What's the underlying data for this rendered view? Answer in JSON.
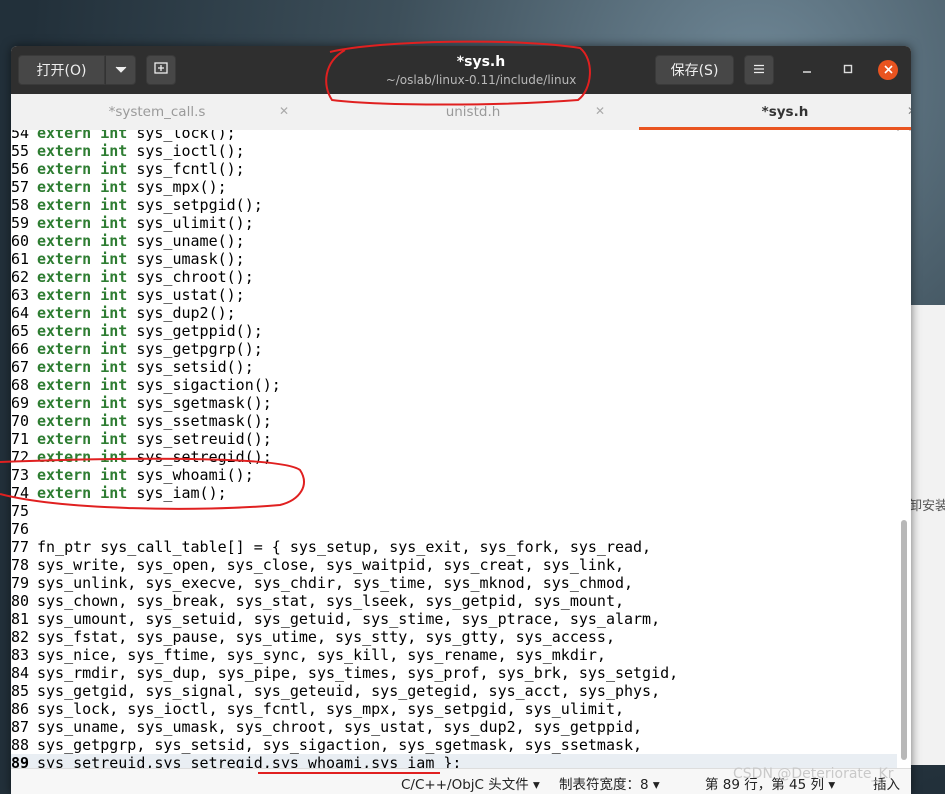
{
  "titlebar": {
    "open_label": "打开(O)",
    "title": "*sys.h",
    "subtitle": "~/oslab/linux-0.11/include/linux",
    "save_label": "保存(S)"
  },
  "tabs": [
    {
      "label": "*system_call.s"
    },
    {
      "label": "unistd.h"
    },
    {
      "label": "*sys.h"
    }
  ],
  "editor": {
    "lines": [
      {
        "n": "54",
        "kw": "extern int",
        "rest": " sys_lock();"
      },
      {
        "n": "55",
        "kw": "extern int",
        "rest": " sys_ioctl();"
      },
      {
        "n": "56",
        "kw": "extern int",
        "rest": " sys_fcntl();"
      },
      {
        "n": "57",
        "kw": "extern int",
        "rest": " sys_mpx();"
      },
      {
        "n": "58",
        "kw": "extern int",
        "rest": " sys_setpgid();"
      },
      {
        "n": "59",
        "kw": "extern int",
        "rest": " sys_ulimit();"
      },
      {
        "n": "60",
        "kw": "extern int",
        "rest": " sys_uname();"
      },
      {
        "n": "61",
        "kw": "extern int",
        "rest": " sys_umask();"
      },
      {
        "n": "62",
        "kw": "extern int",
        "rest": " sys_chroot();"
      },
      {
        "n": "63",
        "kw": "extern int",
        "rest": " sys_ustat();"
      },
      {
        "n": "64",
        "kw": "extern int",
        "rest": " sys_dup2();"
      },
      {
        "n": "65",
        "kw": "extern int",
        "rest": " sys_getppid();"
      },
      {
        "n": "66",
        "kw": "extern int",
        "rest": " sys_getpgrp();"
      },
      {
        "n": "67",
        "kw": "extern int",
        "rest": " sys_setsid();"
      },
      {
        "n": "68",
        "kw": "extern int",
        "rest": " sys_sigaction();"
      },
      {
        "n": "69",
        "kw": "extern int",
        "rest": " sys_sgetmask();"
      },
      {
        "n": "70",
        "kw": "extern int",
        "rest": " sys_ssetmask();"
      },
      {
        "n": "71",
        "kw": "extern int",
        "rest": " sys_setreuid();"
      },
      {
        "n": "72",
        "kw": "extern int",
        "rest": " sys_setregid();"
      },
      {
        "n": "73",
        "kw": "extern int",
        "rest": " sys_whoami();"
      },
      {
        "n": "74",
        "kw": "extern int",
        "rest": " sys_iam();"
      },
      {
        "n": "75",
        "kw": "",
        "rest": ""
      },
      {
        "n": "76",
        "kw": "",
        "rest": ""
      },
      {
        "n": "77",
        "kw": "",
        "rest": "fn_ptr sys_call_table[] = { sys_setup, sys_exit, sys_fork, sys_read,"
      },
      {
        "n": "78",
        "kw": "",
        "rest": "sys_write, sys_open, sys_close, sys_waitpid, sys_creat, sys_link,"
      },
      {
        "n": "79",
        "kw": "",
        "rest": "sys_unlink, sys_execve, sys_chdir, sys_time, sys_mknod, sys_chmod,"
      },
      {
        "n": "80",
        "kw": "",
        "rest": "sys_chown, sys_break, sys_stat, sys_lseek, sys_getpid, sys_mount,"
      },
      {
        "n": "81",
        "kw": "",
        "rest": "sys_umount, sys_setuid, sys_getuid, sys_stime, sys_ptrace, sys_alarm,"
      },
      {
        "n": "82",
        "kw": "",
        "rest": "sys_fstat, sys_pause, sys_utime, sys_stty, sys_gtty, sys_access,"
      },
      {
        "n": "83",
        "kw": "",
        "rest": "sys_nice, sys_ftime, sys_sync, sys_kill, sys_rename, sys_mkdir,"
      },
      {
        "n": "84",
        "kw": "",
        "rest": "sys_rmdir, sys_dup, sys_pipe, sys_times, sys_prof, sys_brk, sys_setgid,"
      },
      {
        "n": "85",
        "kw": "",
        "rest": "sys_getgid, sys_signal, sys_geteuid, sys_getegid, sys_acct, sys_phys,"
      },
      {
        "n": "86",
        "kw": "",
        "rest": "sys_lock, sys_ioctl, sys_fcntl, sys_mpx, sys_setpgid, sys_ulimit,"
      },
      {
        "n": "87",
        "kw": "",
        "rest": "sys_uname, sys_umask, sys_chroot, sys_ustat, sys_dup2, sys_getppid,"
      },
      {
        "n": "88",
        "kw": "",
        "rest": "sys_getpgrp, sys_setsid, sys_sigaction, sys_sgetmask, sys_ssetmask,"
      },
      {
        "n": "89",
        "kw": "",
        "rest": "sys_setreuid,sys_setregid,sys_whoami,sys_iam };",
        "current": true
      }
    ]
  },
  "statusbar": {
    "language": "C/C++/ObjC 头文件 ▾",
    "tab_width": "制表符宽度：8 ▾",
    "position": "第 89 行，第 45 列 ▾",
    "insert_mode": "插入"
  },
  "background_panel_text": "卸安装",
  "watermark": "CSDN @Deteriorate_Kr",
  "colors": {
    "titlebar": "#2f2f2f",
    "accent": "#e95420",
    "keyword": "#2e7d32",
    "annotation": "#e02020"
  },
  "icons": [
    "chevron-down-icon",
    "new-tab-icon",
    "hamburger-menu-icon",
    "minimize-icon",
    "maximize-icon",
    "close-icon"
  ]
}
